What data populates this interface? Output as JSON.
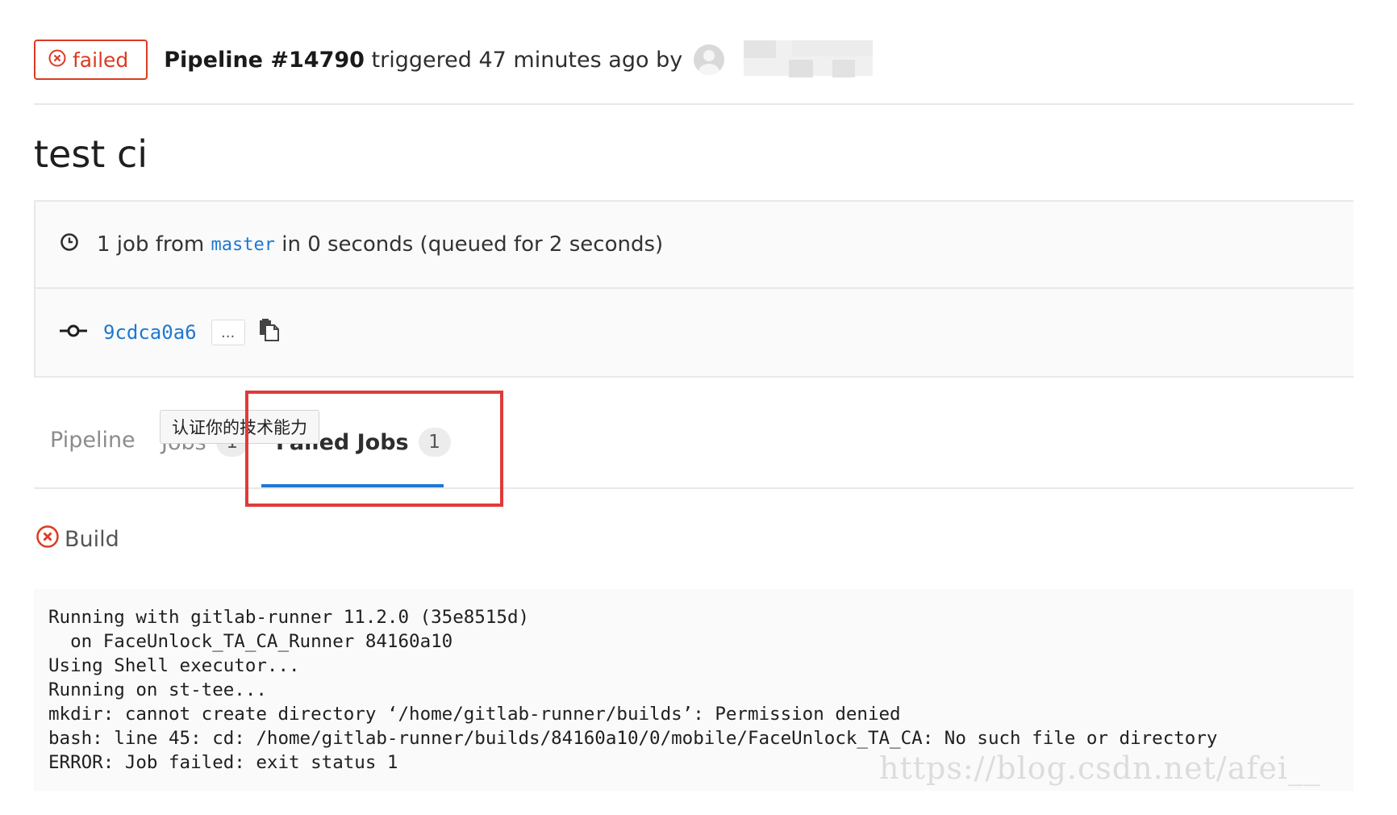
{
  "pipeline": {
    "status": "failed",
    "title": "Pipeline #14790",
    "trigger_text": "triggered 47 minutes ago by"
  },
  "page_title": "test ci",
  "info": {
    "job_count": "1 job from",
    "branch": "master",
    "timing": "in 0 seconds (queued for 2 seconds)",
    "commit_sha": "9cdca0a6",
    "expand_label": "..."
  },
  "tabs": [
    {
      "label": "Pipeline"
    },
    {
      "label": "Jobs",
      "count": "1"
    },
    {
      "label": "Failed Jobs",
      "count": "1",
      "active": true
    }
  ],
  "tooltip": "认证你的技术能力",
  "failed_job": {
    "name": "Build"
  },
  "log_lines": [
    "Running with gitlab-runner 11.2.0 (35e8515d)",
    "  on FaceUnlock_TA_CA_Runner 84160a10",
    "Using Shell executor...",
    "Running on st-tee...",
    "mkdir: cannot create directory ‘/home/gitlab-runner/builds’: Permission denied",
    "bash: line 45: cd: /home/gitlab-runner/builds/84160a10/0/mobile/FaceUnlock_TA_CA: No such file or directory",
    "ERROR: Job failed: exit status 1"
  ],
  "watermark": "https://blog.csdn.net/afei__",
  "icons": {
    "status": "status-failed-icon",
    "clock": "clock-icon",
    "commit": "commit-icon",
    "clipboard": "clipboard-icon"
  },
  "colors": {
    "failed": "#db3b21",
    "link": "#1f78d1",
    "highlight": "#e03a3a"
  }
}
